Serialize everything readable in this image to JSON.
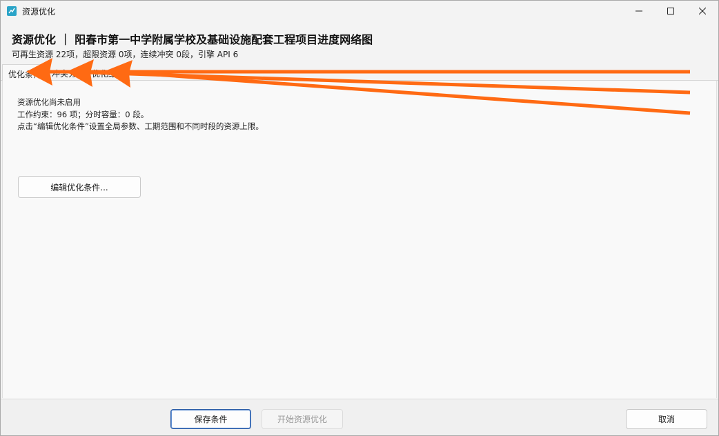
{
  "window": {
    "title": "资源优化"
  },
  "header": {
    "title": "资源优化 ｜ 阳春市第一中学附属学校及基础设施配套工程项目进度网络图",
    "subtitle": "可再生资源 22项，超限资源 0项，连续冲突 0段，引擎 API 6"
  },
  "tabs": [
    {
      "label": "优化条件"
    },
    {
      "label": "冲突分析"
    },
    {
      "label": "优化结果"
    }
  ],
  "main": {
    "status": "资源优化尚未启用",
    "constraints": "工作约束：96 项；分时容量：0 段。",
    "hint": "点击“编辑优化条件”设置全局参数、工期范围和不同时段的资源上限。",
    "edit_button": "编辑优化条件..."
  },
  "footer": {
    "save_button": "保存条件",
    "start_button": "开始资源优化",
    "cancel_button": "取消"
  },
  "colors": {
    "annotation_arrow": "#ff6a13",
    "save_border": "#2f5fa8",
    "app_icon": "#2aa4c8"
  }
}
